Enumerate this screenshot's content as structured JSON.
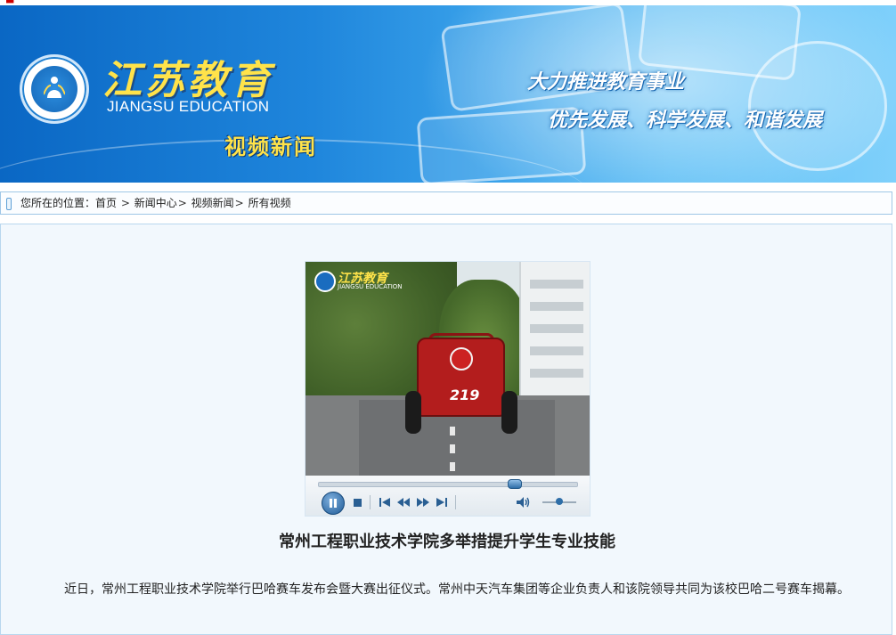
{
  "banner": {
    "brand_cn": "江苏教育",
    "brand_en": "JIANGSU EDUCATION",
    "section_title": "视频新闻",
    "slogan_line1": "大力推进教育事业",
    "slogan_line2": "优先发展、科学发展、和谐发展"
  },
  "breadcrumb": {
    "prefix": "您所在的位置：",
    "items": [
      "首页",
      "新闻中心",
      "视频新闻",
      "所有视频"
    ],
    "separator": ">"
  },
  "video": {
    "watermark_text": "江苏教育",
    "watermark_sub": "JIANGSU EDUCATION",
    "kart_number": "219",
    "progress": 0.77,
    "volume": 0.5
  },
  "article": {
    "title": "常州工程职业技术学院多举措提升学生专业技能",
    "paragraph": "近日，常州工程职业技术学院举行巴哈赛车发布会暨大赛出征仪式。常州中天汽车集团等企业负责人和该院领导共同为该校巴哈二号赛车揭幕。"
  },
  "colors": {
    "banner_blue": "#1f86dc",
    "brand_yellow": "#ffe34a",
    "content_bg": "#f2f8fd"
  }
}
